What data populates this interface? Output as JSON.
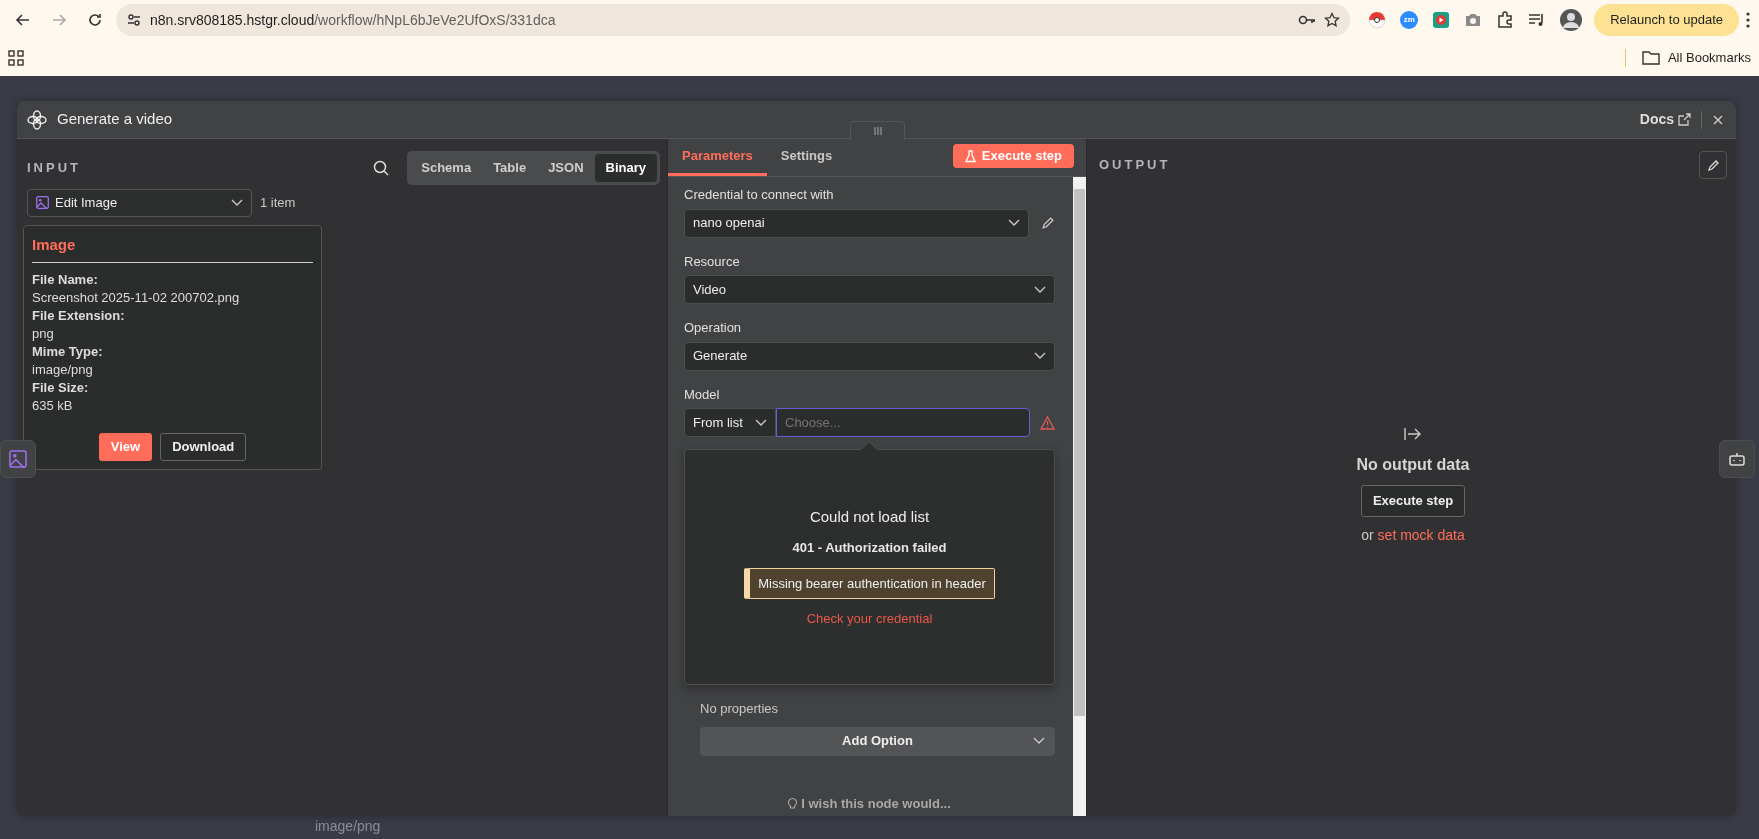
{
  "browser": {
    "url_host": "n8n.srv808185.hstgr.cloud",
    "url_path": "/workflow/hNpL6bJeVe2UfOxS/331dca",
    "zm_badge": "zm",
    "relaunch_button": "Relaunch to update",
    "bookmarks_label": "All Bookmarks"
  },
  "modal": {
    "title": "Generate a video",
    "docs_link": "Docs",
    "input": {
      "heading": "INPUT",
      "view_tabs": [
        {
          "label": "Schema",
          "selected": false
        },
        {
          "label": "Table",
          "selected": false
        },
        {
          "label": "JSON",
          "selected": false
        },
        {
          "label": "Binary",
          "selected": true
        }
      ],
      "node_select": "Edit Image",
      "item_count": "1 item",
      "binary_card": {
        "title": "Image",
        "fields": [
          {
            "label": "File Name:",
            "value": "Screenshot 2025-11-02 200702.png"
          },
          {
            "label": "File Extension:",
            "value": "png"
          },
          {
            "label": "Mime Type:",
            "value": "image/png"
          },
          {
            "label": "File Size:",
            "value": "635 kB"
          }
        ],
        "buttons": [
          {
            "label": "View",
            "kind": "primary"
          },
          {
            "label": "Download",
            "kind": "outline"
          }
        ]
      }
    },
    "parameters": {
      "tabs": [
        {
          "label": "Parameters",
          "selected": true
        },
        {
          "label": "Settings",
          "selected": false
        }
      ],
      "execute_button": "Execute step",
      "fields": [
        {
          "label": "Credential to connect with",
          "value": "nano openai",
          "kind": "credential"
        },
        {
          "label": "Resource",
          "value": "Video",
          "kind": "select"
        },
        {
          "label": "Operation",
          "value": "Generate",
          "kind": "select"
        }
      ],
      "model": {
        "label": "Model",
        "mode": "From list",
        "placeholder": "Choose..."
      },
      "error": {
        "title": "Could not load list",
        "code": "401 - Authorization failed",
        "message": "Missing bearer authentication in header",
        "link": "Check your credential"
      },
      "options_note": "No properties",
      "add_option": "Add Option",
      "feedback": "I wish this node would..."
    },
    "output": {
      "heading": "OUTPUT",
      "empty_title": "No output data",
      "execute_button": "Execute step",
      "mock_prefix": "or",
      "mock_link": "set mock data"
    }
  },
  "background_texts": [
    "image/png"
  ]
}
